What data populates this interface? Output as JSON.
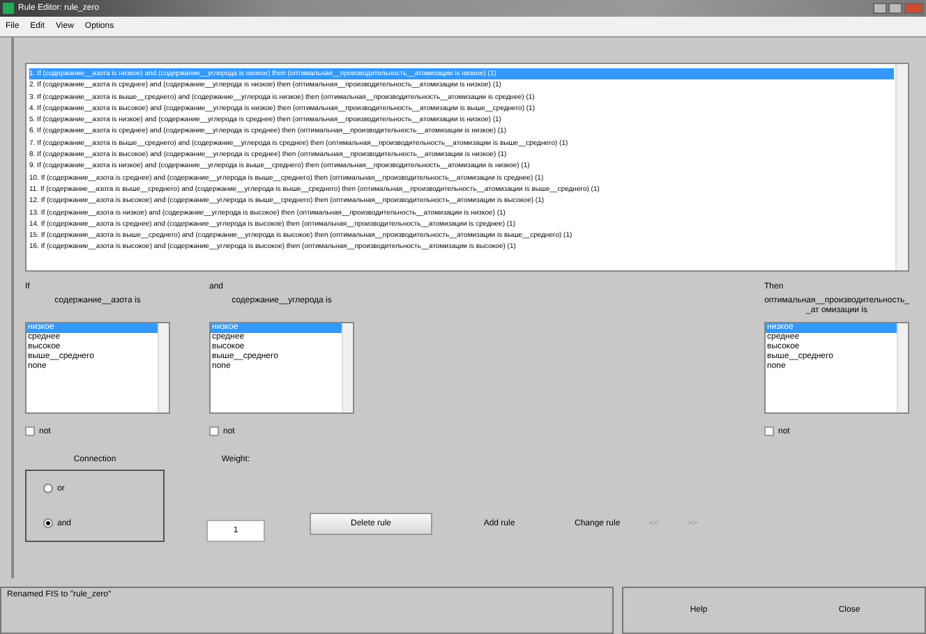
{
  "window": {
    "title": "Rule Editor: rule_zero"
  },
  "menu": [
    "File",
    "Edit",
    "View",
    "Options"
  ],
  "rules": [
    {
      "text": "1. If (содержание__азота is низкое) and (содержание__углерода is низкое) then (оптимальная__производительность__атомизации is низкое) (1)",
      "selected": true
    },
    {
      "text": "2. If (содержание__азота is среднее) and (содержание__углерода is низкое) then (оптимальная__производительность__атомизации is низкое) (1)",
      "selected": false
    },
    {
      "text": "3. If (содержание__азота is выше__среднего) and (содержание__углерода is низкое) then (оптимальная__производительность__атомизации is среднее) (1)",
      "selected": false
    },
    {
      "text": "4. If (содержание__азота is высокое) and (содержание__углерода is низкое) then (оптимальная__производительность__атомизации is выше__среднего) (1)",
      "selected": false
    },
    {
      "text": "5. If (содержание__азота is низкое) and (содержание__углерода is среднее) then (оптимальная__производительность__атомизации is низкое) (1)",
      "selected": false
    },
    {
      "text": "6. If (содержание__азота is среднее) and (содержание__углерода is среднее) then (оптимальная__производительность__атомизации is низкое) (1)",
      "selected": false
    },
    {
      "text": "7. If (содержание__азота is выше__среднего) and (содержание__углерода is среднее) then (оптимальная__производительность__атомизации is выше__среднего) (1)",
      "selected": false
    },
    {
      "text": "8. If (содержание__азота is высокое) and (содержание__углерода is среднее) then (оптимальная__производительность__атомизации is низкое) (1)",
      "selected": false
    },
    {
      "text": "9. If (содержание__азота is низкое) and (содержание__углерода is выше__среднего) then (оптимальная__производительность__атомизации is низкое) (1)",
      "selected": false
    },
    {
      "text": "10. If (содержание__азота is среднее) and (содержание__углерода is выше__среднего) then (оптимальная__производительность__атомизации is среднее) (1)",
      "selected": false
    },
    {
      "text": "11. If (содержание__азота is выше__среднего) and (содержание__углерода is выше__среднего) then (оптимальная__производительность__атомизации is выше__среднего) (1)",
      "selected": false
    },
    {
      "text": "12. If (содержание__азота is высокое) and (содержание__углерода is выше__среднего) then (оптимальная__производительность__атомизации is высокое) (1)",
      "selected": false
    },
    {
      "text": "13. If (содержание__азота is низкое) and (содержание__углерода is высокое) then (оптимальная__производительность__атомизации is низкое) (1)",
      "selected": false
    },
    {
      "text": "14. If (содержание__азота is среднее) and (содержание__углерода is высокое) then (оптимальная__производительность__атомизации is среднее) (1)",
      "selected": false
    },
    {
      "text": "15. If (содержание__азота is выше__среднего) and (содержание__углерода is высокое) then (оптимальная__производительность__атомизации is выше__среднего) (1)",
      "selected": false
    },
    {
      "text": "16. If (содержание__азота is высокое) and (содержание__углерода is высокое) then (оптимальная__производительность__атомизации is высокое) (1)",
      "selected": false
    }
  ],
  "columns": [
    {
      "kind": "input",
      "heading": "If",
      "variable": "содержание__азота is",
      "terms": [
        {
          "label": "низкое",
          "selected": true
        },
        {
          "label": "среднее",
          "selected": false
        },
        {
          "label": "высокое",
          "selected": false
        },
        {
          "label": "выше__среднего",
          "selected": false
        },
        {
          "label": "none",
          "selected": false
        }
      ],
      "not": {
        "label": "not",
        "checked": false
      }
    },
    {
      "kind": "input",
      "heading": "and",
      "variable": "содержание__углерода is",
      "terms": [
        {
          "label": "низкое",
          "selected": true
        },
        {
          "label": "среднее",
          "selected": false
        },
        {
          "label": "высокое",
          "selected": false
        },
        {
          "label": "выше__среднего",
          "selected": false
        },
        {
          "label": "none",
          "selected": false
        }
      ],
      "not": {
        "label": "not",
        "checked": false
      }
    },
    {
      "kind": "output",
      "heading": "Then",
      "variable": "оптимальная__производительность__ат омизации is",
      "terms": [
        {
          "label": "низкое",
          "selected": true
        },
        {
          "label": "среднее",
          "selected": false
        },
        {
          "label": "высокое",
          "selected": false
        },
        {
          "label": "выше__среднего",
          "selected": false
        },
        {
          "label": "none",
          "selected": false
        }
      ],
      "not": {
        "label": "not",
        "checked": false
      }
    }
  ],
  "connection": {
    "title": "Connection",
    "options": [
      {
        "label": "or",
        "selected": false
      },
      {
        "label": "and",
        "selected": true
      }
    ]
  },
  "weight": {
    "label": "Weight:",
    "value": "1"
  },
  "buttons": [
    {
      "label": "Delete rule",
      "kind": "raised",
      "disabled": false
    },
    {
      "label": "Add rule",
      "kind": "flat",
      "disabled": false
    },
    {
      "label": "Change rule",
      "kind": "flat",
      "disabled": false
    },
    {
      "label": "<<",
      "kind": "flat",
      "disabled": true
    },
    {
      "label": ">>",
      "kind": "flat",
      "disabled": true
    }
  ],
  "status": "Renamed FIS to \"rule_zero\"",
  "footer_buttons": [
    "Help",
    "Close"
  ]
}
